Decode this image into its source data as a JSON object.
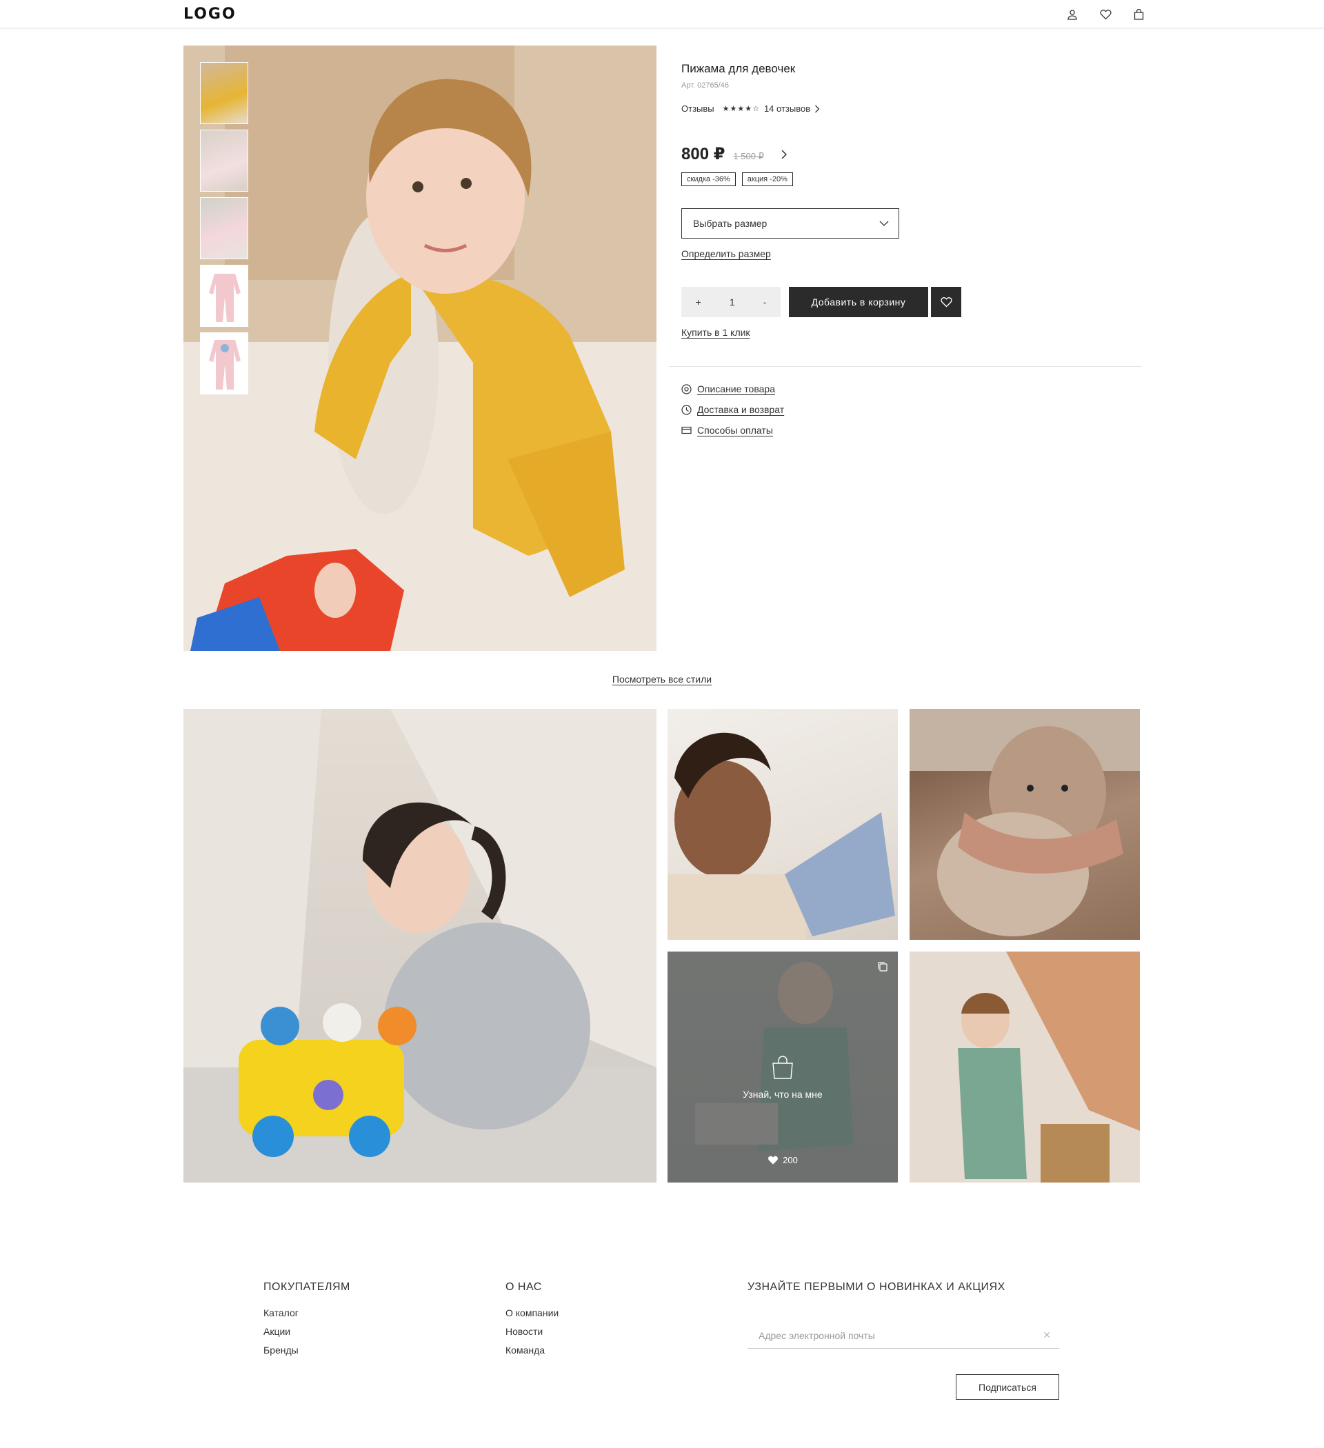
{
  "header": {
    "logo": "LOGO",
    "icons": [
      "user-icon",
      "heart-icon",
      "bag-icon"
    ]
  },
  "product": {
    "title": "Пижама для девочек",
    "sku": "Арт. 02765/46",
    "reviews_label": "Отзывы",
    "rating": 4,
    "reviews_count": "14 отзывов",
    "price": "800 ₽",
    "old_price": "1 500 ₽",
    "badges": [
      "скидка -36%",
      "акция -20%"
    ],
    "size_select": "Выбрать размер",
    "size_guide": "Определить размер",
    "qty_plus": "+",
    "quantity": "1",
    "qty_minus": "-",
    "add_to_cart": "Добавить в корзину",
    "buy_one_click": "Купить в 1 клик",
    "accordion": [
      {
        "icon": "tag-icon",
        "label": "Описание товара"
      },
      {
        "icon": "clock-icon",
        "label": "Доставка и возврат"
      },
      {
        "icon": "card-icon",
        "label": "Способы оплаты"
      }
    ]
  },
  "styles_link": "Посмотреть все стили",
  "gallery": {
    "overlay_text": "Узнай, что на мне",
    "likes": "200"
  },
  "footer": {
    "col1": {
      "title": "ПОКУПАТЕЛЯМ",
      "links": [
        "Каталог",
        "Акции",
        "Бренды"
      ]
    },
    "col2": {
      "title": "О НАС",
      "links": [
        "О компании",
        "Новости",
        "Команда"
      ]
    },
    "newsletter": {
      "title": "УЗНАЙТЕ ПЕРВЫМИ О НОВИНКАХ И АКЦИЯХ",
      "placeholder": "Адрес электронной почты",
      "button": "Подписаться"
    }
  }
}
